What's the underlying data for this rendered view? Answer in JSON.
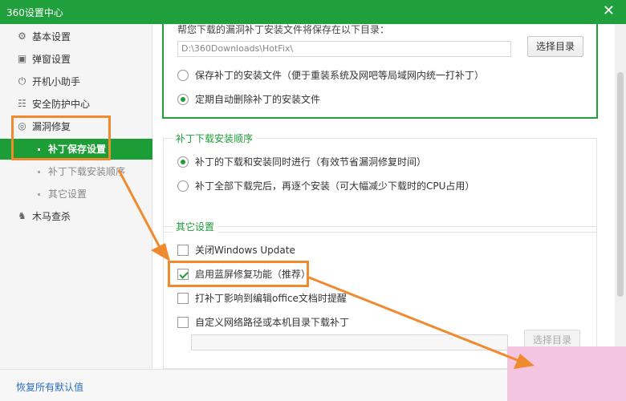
{
  "window": {
    "title": "360设置中心",
    "close_glyph": "✕"
  },
  "sidebar": {
    "items": [
      {
        "label": "基本设置",
        "icon": "gear-icon",
        "glyph": "⚙"
      },
      {
        "label": "弹窗设置",
        "icon": "window-icon",
        "glyph": "▣"
      },
      {
        "label": "开机小助手",
        "icon": "power-icon",
        "glyph": "⏻"
      },
      {
        "label": "安全防护中心",
        "icon": "shield-list-icon",
        "glyph": "☷"
      },
      {
        "label": "漏洞修复",
        "icon": "patch-icon",
        "glyph": "◎"
      },
      {
        "label": "木马查杀",
        "icon": "horse-icon",
        "glyph": "♞"
      }
    ],
    "sub_items": [
      {
        "label": "补丁保存设置",
        "active": true
      },
      {
        "label": "补丁下载安装顺序",
        "active": false
      },
      {
        "label": "其它设置",
        "active": false
      }
    ]
  },
  "save_group": {
    "hint": "帮您下载的漏洞补丁安装文件将保存在以下目录：",
    "path_value": "D:\\360Downloads\\HotFix\\",
    "browse_label": "选择目录",
    "options": [
      {
        "label": "保存补丁的安装文件（便于重装系统及网吧等局域网内统一打补丁）",
        "selected": false
      },
      {
        "label": "定期自动删除补丁的安装文件",
        "selected": true
      }
    ]
  },
  "order_group": {
    "title": "补丁下载安装顺序",
    "options": [
      {
        "label": "补丁的下载和安装同时进行（有效节省漏洞修复时间）",
        "selected": true
      },
      {
        "label": "补丁全部下载完后，再逐个安装（可大幅减少下载时的CPU占用）",
        "selected": false
      }
    ]
  },
  "other_group": {
    "title": "其它设置",
    "options": [
      {
        "label": "关闭Windows Update",
        "checked": false
      },
      {
        "label": "启用蓝屏修复功能（推荐）",
        "checked": true
      },
      {
        "label": "打补丁影响到编辑office文档时提醒",
        "checked": false
      },
      {
        "label": "自定义网络路径或本机目录下载补丁",
        "checked": false
      }
    ],
    "custom_path_value": "",
    "browse_label": "选择目录"
  },
  "footer": {
    "reset_label": "恢复所有默认值"
  },
  "colors": {
    "brand_green": "#20a03d",
    "annotation_orange": "#f08a2e",
    "link_blue": "#2a6dbf"
  }
}
